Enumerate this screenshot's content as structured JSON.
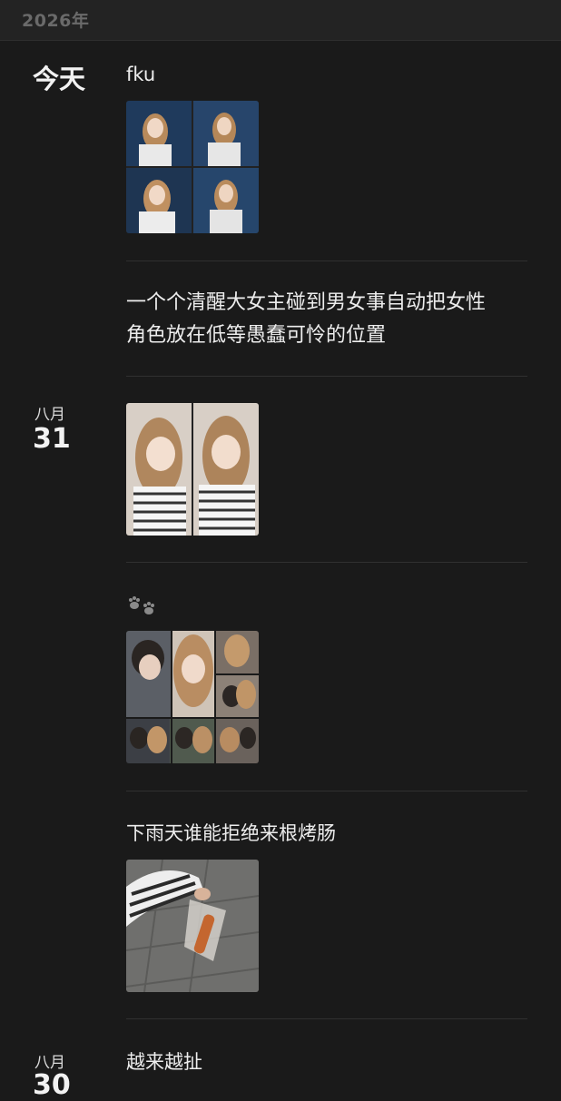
{
  "header": {
    "year": "2026年"
  },
  "today_label": "今天",
  "posts": {
    "p1": {
      "text": "fku",
      "thumb_icon": "photo-grid-4"
    },
    "p2": {
      "text_line1": "一个个清醒大女主碰到男女事自动把女性",
      "text_line2": "角色放在低等愚蠢可怜的位置"
    },
    "p3": {
      "month": "八月",
      "day": "31",
      "thumb_icon": "photo-grid-2"
    },
    "p4": {
      "icon": "paw-print-icon",
      "thumb_icon": "photo-collage"
    },
    "p5": {
      "text": "下雨天谁能拒绝来根烤肠",
      "thumb_icon": "photo-sausage"
    },
    "p6": {
      "month": "八月",
      "day": "30",
      "text": "越来越扯"
    }
  },
  "colors": {
    "background": "#1a1a1a",
    "divider": "#303030",
    "year_text": "#6a6a6a"
  }
}
